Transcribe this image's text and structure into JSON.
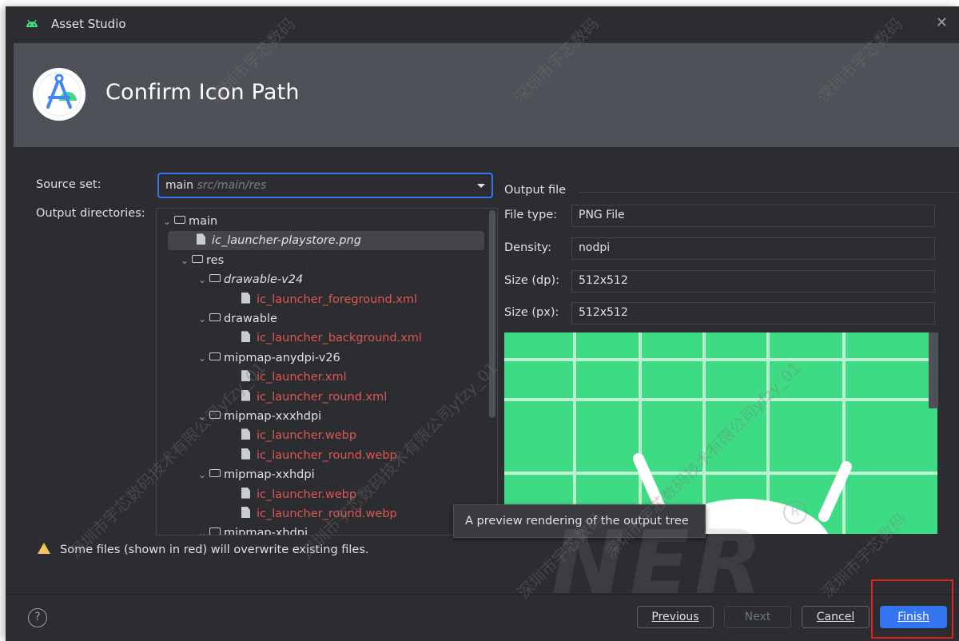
{
  "window": {
    "title": "Asset Studio",
    "close_glyph": "✕"
  },
  "header": {
    "heading": "Confirm Icon Path"
  },
  "source_set": {
    "label": "Source set:",
    "value": "main",
    "hint": "src/main/res"
  },
  "output_directories": {
    "label": "Output directories:",
    "tree": [
      {
        "text": "main",
        "kind": "folder",
        "expanded": true
      },
      {
        "text": "ic_launcher-playstore.png",
        "kind": "file",
        "selected": true,
        "italic": true
      },
      {
        "text": "res",
        "kind": "folder",
        "expanded": true
      },
      {
        "text": "drawable-v24",
        "kind": "folder",
        "expanded": true,
        "italic": true
      },
      {
        "text": "ic_launcher_foreground.xml",
        "kind": "file",
        "overwrite": true
      },
      {
        "text": "drawable",
        "kind": "folder",
        "expanded": true
      },
      {
        "text": "ic_launcher_background.xml",
        "kind": "file",
        "overwrite": true
      },
      {
        "text": "mipmap-anydpi-v26",
        "kind": "folder",
        "expanded": true
      },
      {
        "text": "ic_launcher.xml",
        "kind": "file",
        "overwrite": true
      },
      {
        "text": "ic_launcher_round.xml",
        "kind": "file",
        "overwrite": true
      },
      {
        "text": "mipmap-xxxhdpi",
        "kind": "folder",
        "expanded": true
      },
      {
        "text": "ic_launcher.webp",
        "kind": "file",
        "overwrite": true
      },
      {
        "text": "ic_launcher_round.webp",
        "kind": "file",
        "overwrite": true
      },
      {
        "text": "mipmap-xxhdpi",
        "kind": "folder",
        "expanded": true
      },
      {
        "text": "ic_launcher.webp",
        "kind": "file",
        "overwrite": true
      },
      {
        "text": "ic_launcher_round.webp",
        "kind": "file",
        "overwrite": true
      },
      {
        "text": "mipmap-xhdpi",
        "kind": "folder",
        "expanded": true
      }
    ]
  },
  "output_file": {
    "title": "Output file",
    "fields": [
      {
        "label": "File type:",
        "value": "PNG File"
      },
      {
        "label": "Density:",
        "value": "nodpi"
      },
      {
        "label": "Size (dp):",
        "value": "512x512"
      },
      {
        "label": "Size (px):",
        "value": "512x512"
      }
    ]
  },
  "tooltip": "A preview rendering of the output tree",
  "warning": "Some files (shown in red) will overwrite existing files.",
  "buttons": {
    "help": "?",
    "previous": "Previous",
    "next": "Next",
    "cancel": "Cancel",
    "finish": "Finish"
  },
  "watermarks": [
    "深圳市宇芯数码技术有限公司yfzy_01",
    "深圳市宇芯数码技术有限公司yfzy_01",
    "深圳市宇芯数码技术有限公司yfzy_01",
    "深圳市宇芯数码",
    "深圳市宇芯数码",
    "深圳市宇芯数码",
    "深圳市宇芯数码",
    "深圳市宇芯数码"
  ],
  "watermark_brand": "NER",
  "watermark_reg": "R",
  "colors": {
    "dialog_bg": "#2b2d30",
    "header_bg": "#4e5157",
    "accent": "#3574f0",
    "overwrite_red": "#e05555",
    "preview_green": "#3ddc84",
    "highlight_box": "#e02020"
  }
}
